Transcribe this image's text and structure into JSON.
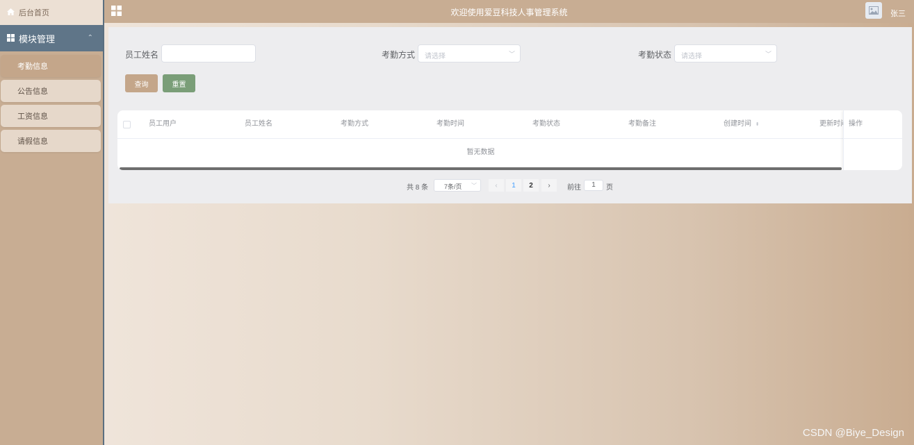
{
  "sidebar": {
    "home_label": "后台首页",
    "group_label": "模块管理",
    "items": [
      {
        "label": "考勤信息"
      },
      {
        "label": "公告信息"
      },
      {
        "label": "工资信息"
      },
      {
        "label": "请假信息"
      }
    ]
  },
  "header": {
    "title": "欢迎使用爱豆科技人事管理系统",
    "user": "张三"
  },
  "search": {
    "name_label": "员工姓名",
    "name_value": "",
    "method_label": "考勤方式",
    "method_placeholder": "请选择",
    "status_label": "考勤状态",
    "status_placeholder": "请选择",
    "query_button": "查询",
    "reset_button": "重置"
  },
  "table": {
    "columns": [
      "员工用户",
      "员工姓名",
      "考勤方式",
      "考勤时间",
      "考勤状态",
      "考勤备注",
      "创建时间",
      "更新时间"
    ],
    "action_column": "操作",
    "empty_text": "暂无数据"
  },
  "pagination": {
    "total_text": "共 8 条",
    "page_size": "7条/页",
    "pages": [
      "1",
      "2"
    ],
    "current_page": "1",
    "goto_label": "前往",
    "goto_value": "1",
    "page_unit": "页"
  },
  "watermark": "CSDN @Biye_Design",
  "colors": {
    "sidebar": "#c8ad93",
    "active_group": "#5f7588",
    "query_button": "#c4a68a",
    "reset_button": "#7a9e78",
    "active_page": "#409eff"
  }
}
